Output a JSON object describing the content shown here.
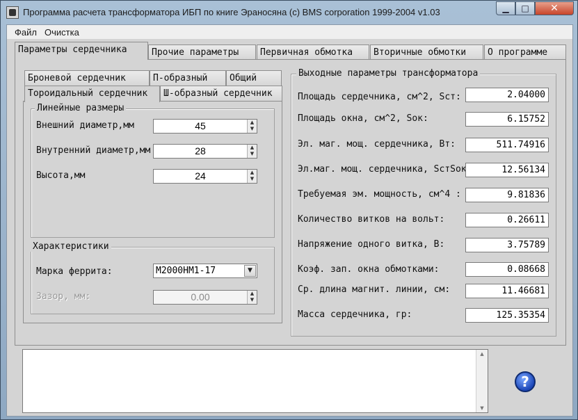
{
  "window": {
    "title": "Программа расчета трансформатора ИБП по книге Эраносяна        (c) BMS corporation 1999-2004  v1.03",
    "minimize": "▁",
    "maximize": "□",
    "close": "✕"
  },
  "menu": [
    "Файл",
    "Очистка"
  ],
  "main_tabs": [
    "Параметры сердечника",
    "Прочие параметры",
    "Первичная обмотка",
    "Вторичные обмотки",
    "О программе"
  ],
  "core_tabs": {
    "row1": [
      "Броневой сердечник",
      "П-образный",
      "Общий"
    ],
    "row2": [
      "Тороидальный сердечник",
      "Ш-образный сердечник"
    ]
  },
  "linear": {
    "title": "Линейные размеры",
    "fields": [
      {
        "label": "Внешний диаметр,мм",
        "value": "45"
      },
      {
        "label": "Внутренний диаметр,мм",
        "value": "28"
      },
      {
        "label": "Высота,мм",
        "value": "24"
      }
    ]
  },
  "characteristics": {
    "title": "Характеристики",
    "ferrite_label": "Марка феррита:",
    "ferrite_value": "М2000НМ1-17",
    "gap_label": "Зазор, мм:",
    "gap_value": "0.00"
  },
  "outputs": {
    "title": "Выходные параметры трансформатора",
    "items": [
      {
        "label": "Площадь сердечника, см^2, Sст:",
        "value": "2.04000"
      },
      {
        "label": "Площадь окна, см^2, Sок:",
        "value": "6.15752"
      },
      {
        "label": "Эл. маг. мощ. сердечника, Вт:",
        "value": "511.74916"
      },
      {
        "label": "Эл.маг. мощ. сердечника, SстSок:",
        "value": "12.56134"
      },
      {
        "label": "Требуемая эм. мощность, см^4 :",
        "value": "9.81836"
      },
      {
        "label": "Количество витков на вольт:",
        "value": "0.26611"
      },
      {
        "label": "Напряжение одного витка, В:",
        "value": "3.75789"
      },
      {
        "label": "Коэф. зап. окна обмотками:",
        "value": "0.08668"
      },
      {
        "label": "Ср. длина магнит. линии, см:",
        "value": "11.46681"
      },
      {
        "label": "Масса сердечника, гр:",
        "value": "125.35354"
      }
    ]
  },
  "help": "?",
  "icons": {
    "spin_up": "▲",
    "spin_down": "▼",
    "dropdown": "▼"
  }
}
